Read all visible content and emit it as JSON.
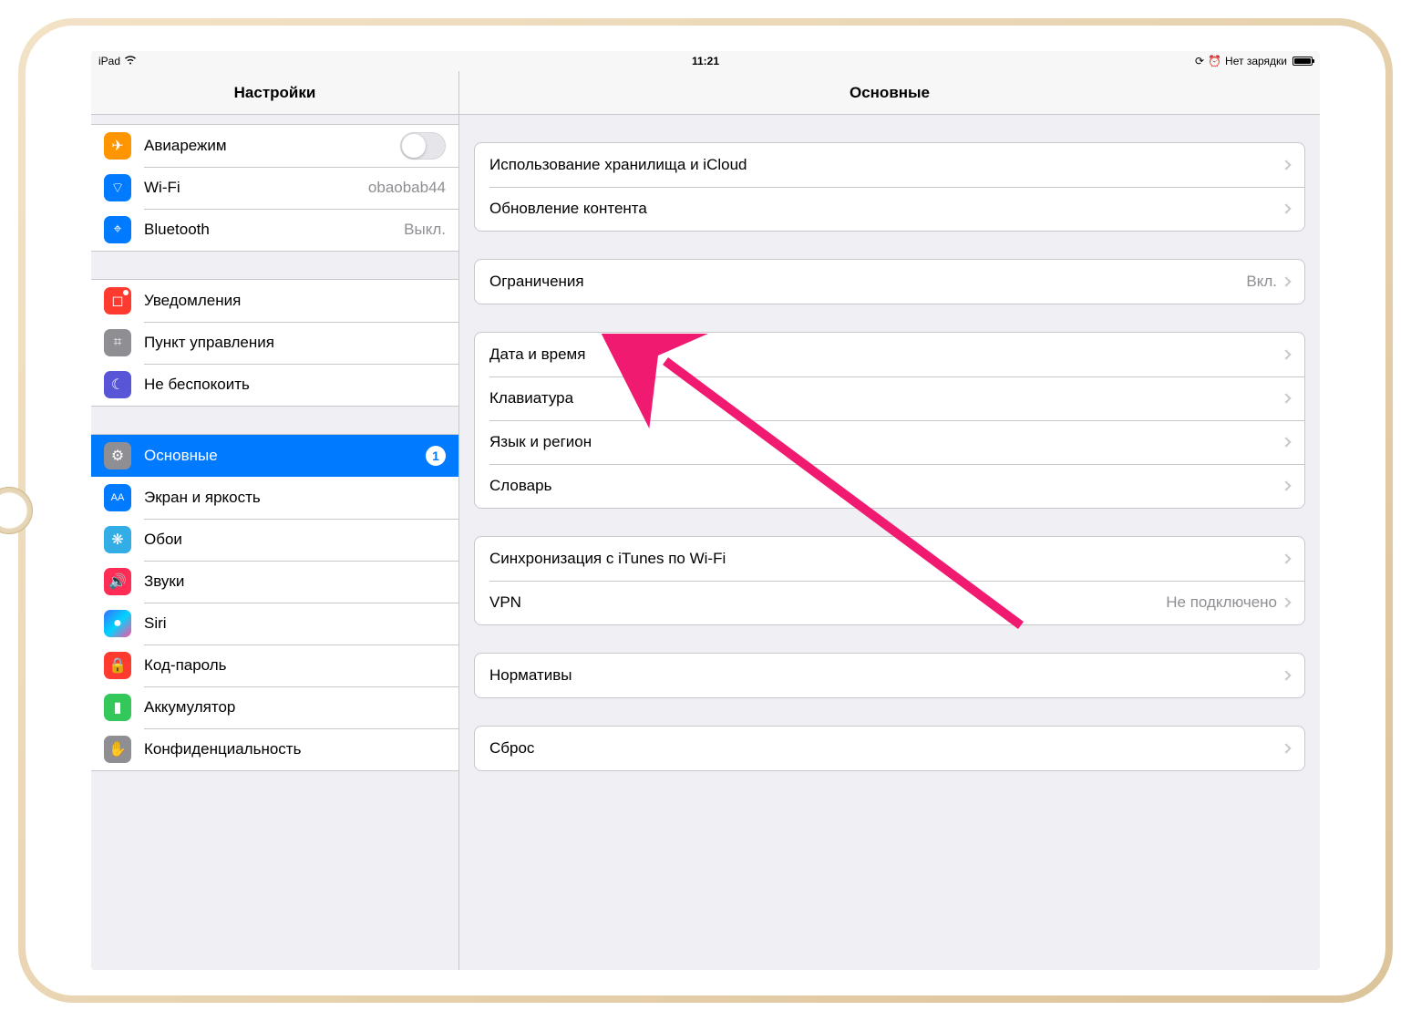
{
  "status": {
    "device": "iPad",
    "time": "11:21",
    "charge": "Нет зарядки"
  },
  "sidebar": {
    "title": "Настройки",
    "groups": [
      {
        "items": [
          {
            "name": "airplane-mode",
            "label": "Авиарежим",
            "icon": "airplane-icon",
            "iconColor": "ic-orange",
            "glyph": "✈",
            "control": "toggle"
          },
          {
            "name": "wifi",
            "label": "Wi-Fi",
            "icon": "wifi-icon",
            "iconColor": "ic-blue",
            "glyph": "⌔",
            "value": "obaobab44"
          },
          {
            "name": "bluetooth",
            "label": "Bluetooth",
            "icon": "bluetooth-icon",
            "iconColor": "ic-blue",
            "glyph": "⌖",
            "value": "Выкл."
          }
        ]
      },
      {
        "items": [
          {
            "name": "notifications",
            "label": "Уведомления",
            "icon": "notifications-icon",
            "iconColor": "ic-notif",
            "glyph": "◻"
          },
          {
            "name": "control-center",
            "label": "Пункт управления",
            "icon": "control-center-icon",
            "iconColor": "ic-gray",
            "glyph": "⌗"
          },
          {
            "name": "do-not-disturb",
            "label": "Не беспокоить",
            "icon": "moon-icon",
            "iconColor": "ic-purple",
            "glyph": "☾"
          }
        ]
      },
      {
        "items": [
          {
            "name": "general",
            "label": "Основные",
            "icon": "gear-icon",
            "iconColor": "ic-gray",
            "glyph": "⚙",
            "selected": true,
            "badge": "1"
          },
          {
            "name": "display-brightness",
            "label": "Экран и яркость",
            "icon": "display-icon",
            "iconColor": "ic-blue",
            "glyph": "AA"
          },
          {
            "name": "wallpaper",
            "label": "Обои",
            "icon": "wallpaper-icon",
            "iconColor": "ic-cyan",
            "glyph": "❋"
          },
          {
            "name": "sounds",
            "label": "Звуки",
            "icon": "sounds-icon",
            "iconColor": "ic-pink",
            "glyph": "🔊"
          },
          {
            "name": "siri",
            "label": "Siri",
            "icon": "siri-icon",
            "iconColor": "ic-siri",
            "glyph": "●"
          },
          {
            "name": "passcode",
            "label": "Код-пароль",
            "icon": "lock-icon",
            "iconColor": "ic-red",
            "glyph": "🔒"
          },
          {
            "name": "battery",
            "label": "Аккумулятор",
            "icon": "battery-icon",
            "iconColor": "ic-green",
            "glyph": "▮"
          },
          {
            "name": "privacy",
            "label": "Конфиденциальность",
            "icon": "hand-icon",
            "iconColor": "ic-gray",
            "glyph": "✋"
          }
        ]
      }
    ]
  },
  "detail": {
    "title": "Основные",
    "groups": [
      {
        "items": [
          {
            "name": "storage-icloud",
            "label": "Использование хранилища и iCloud"
          },
          {
            "name": "background-refresh",
            "label": "Обновление контента"
          }
        ]
      },
      {
        "items": [
          {
            "name": "restrictions",
            "label": "Ограничения",
            "value": "Вкл."
          }
        ]
      },
      {
        "items": [
          {
            "name": "date-time",
            "label": "Дата и время"
          },
          {
            "name": "keyboard",
            "label": "Клавиатура"
          },
          {
            "name": "language-region",
            "label": "Язык и регион"
          },
          {
            "name": "dictionary",
            "label": "Словарь"
          }
        ]
      },
      {
        "items": [
          {
            "name": "itunes-wifi-sync",
            "label": "Синхронизация с iTunes по Wi-Fi"
          },
          {
            "name": "vpn",
            "label": "VPN",
            "value": "Не подключено"
          }
        ]
      },
      {
        "items": [
          {
            "name": "regulatory",
            "label": "Нормативы"
          }
        ]
      },
      {
        "items": [
          {
            "name": "reset",
            "label": "Сброс"
          }
        ]
      }
    ]
  },
  "annotation": {
    "arrowColor": "#f01a70"
  }
}
